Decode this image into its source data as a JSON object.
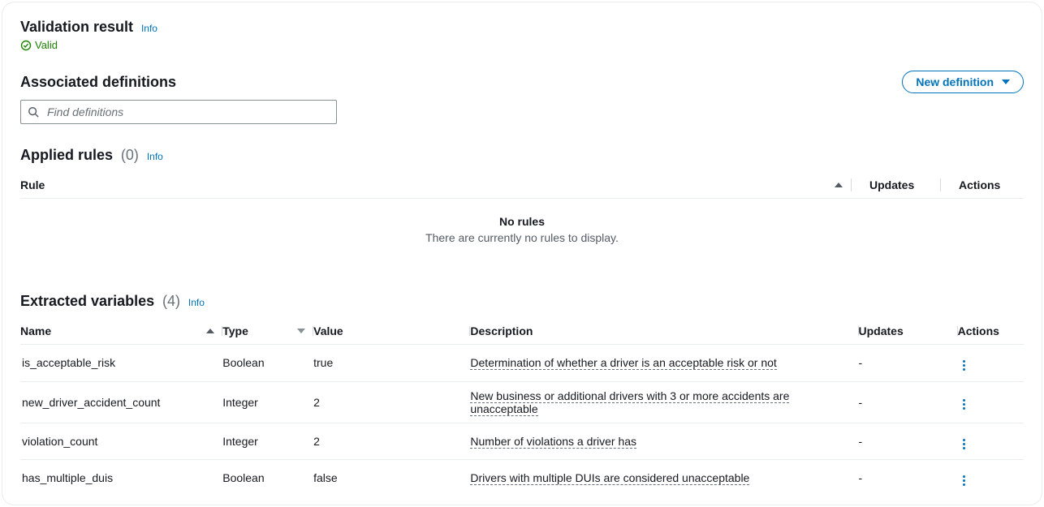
{
  "validation": {
    "title": "Validation result",
    "info": "Info",
    "status": "Valid"
  },
  "definitions": {
    "title": "Associated definitions",
    "search_placeholder": "Find definitions",
    "new_button": "New definition"
  },
  "rules": {
    "title": "Applied rules",
    "count": "(0)",
    "info": "Info",
    "headers": {
      "rule": "Rule",
      "updates": "Updates",
      "actions": "Actions"
    },
    "empty_title": "No rules",
    "empty_sub": "There are currently no rules to display."
  },
  "variables": {
    "title": "Extracted variables",
    "count": "(4)",
    "info": "Info",
    "headers": {
      "name": "Name",
      "type": "Type",
      "value": "Value",
      "description": "Description",
      "updates": "Updates",
      "actions": "Actions"
    },
    "rows": [
      {
        "name": "is_acceptable_risk",
        "type": "Boolean",
        "value": "true",
        "description": "Determination of whether a driver is an acceptable risk or not",
        "updates": "-"
      },
      {
        "name": "new_driver_accident_count",
        "type": "Integer",
        "value": "2",
        "description": "New business or additional drivers with 3 or more accidents are unacceptable",
        "updates": "-"
      },
      {
        "name": "violation_count",
        "type": "Integer",
        "value": "2",
        "description": "Number of violations a driver has",
        "updates": "-"
      },
      {
        "name": "has_multiple_duis",
        "type": "Boolean",
        "value": "false",
        "description": "Drivers with multiple DUIs are considered unacceptable",
        "updates": "-"
      }
    ]
  }
}
